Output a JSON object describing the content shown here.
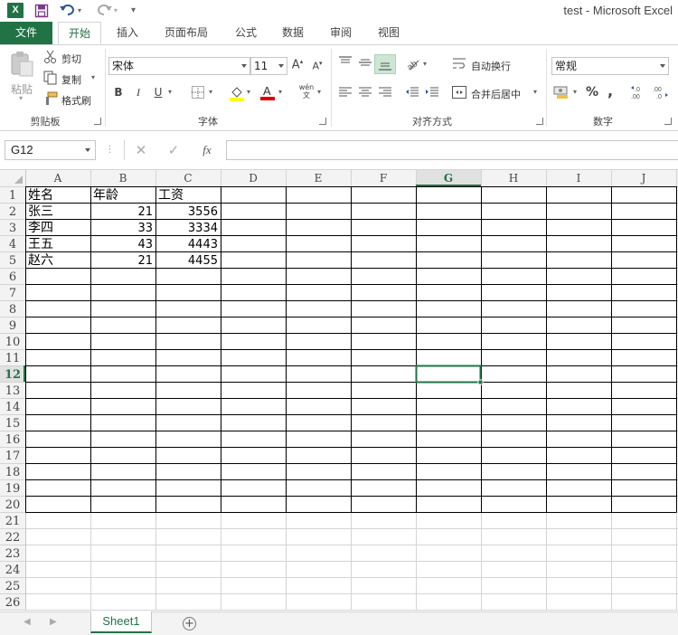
{
  "app": {
    "title": "test - Microsoft Excel",
    "logo_letter": "X"
  },
  "tabs": [
    {
      "label": "文件"
    },
    {
      "label": "开始"
    },
    {
      "label": "插入"
    },
    {
      "label": "页面布局"
    },
    {
      "label": "公式"
    },
    {
      "label": "数据"
    },
    {
      "label": "审阅"
    },
    {
      "label": "视图"
    }
  ],
  "ribbon": {
    "clipboard": {
      "label": "剪贴板",
      "paste": "粘贴",
      "cut": "剪切",
      "copy": "复制",
      "format_painter": "格式刷"
    },
    "font": {
      "label": "字体",
      "font_name": "宋体",
      "font_size": "11",
      "bold": "B",
      "italic": "I",
      "underline": "U"
    },
    "alignment": {
      "label": "对齐方式",
      "wrap_text": "自动换行",
      "merge_center": "合并后居中"
    },
    "number": {
      "label": "数字",
      "format": "常规",
      "percent": "%",
      "comma": ","
    }
  },
  "formula_bar": {
    "name_box": "G12",
    "fx_label": "fx",
    "value": ""
  },
  "grid": {
    "columns": [
      "A",
      "B",
      "C",
      "D",
      "E",
      "F",
      "G",
      "H",
      "I",
      "J"
    ],
    "row_count": 26,
    "selected_column": "G",
    "selected_row": 12,
    "bordered_rows": 20,
    "bordered_cols": 10,
    "cells": [
      [
        "姓名",
        "年龄",
        "工资"
      ],
      [
        "张三",
        "21",
        "3556"
      ],
      [
        "李四",
        "33",
        "3334"
      ],
      [
        "王五",
        "43",
        "4443"
      ],
      [
        "赵六",
        "21",
        "4455"
      ]
    ]
  },
  "sheets": {
    "active": "Sheet1"
  },
  "colors": {
    "accent": "#217346",
    "header_bg": "#f3f3f3",
    "selected_header_bg": "#e1e1e1",
    "gridline": "#d4d4d4"
  }
}
